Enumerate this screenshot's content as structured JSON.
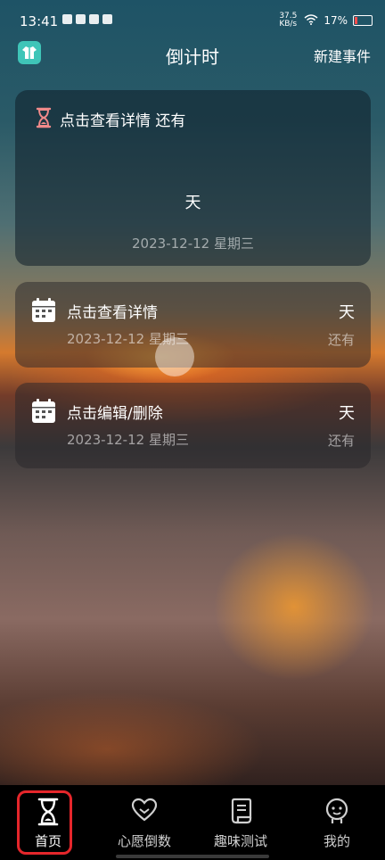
{
  "status_bar": {
    "time": "13:41",
    "net_speed": "37.5 KB/s",
    "battery": "17%"
  },
  "header": {
    "title": "倒计时",
    "action": "新建事件",
    "app_icon": "shirt-icon"
  },
  "hero": {
    "title": "点击查看详情 还有",
    "unit": "天",
    "date": "2023-12-12 星期三",
    "icon": "hourglass-icon"
  },
  "events": [
    {
      "title": "点击查看详情",
      "date": "2023-12-12 星期三",
      "unit": "天",
      "remain_label": "还有",
      "icon": "calendar-icon"
    },
    {
      "title": "点击编辑/删除",
      "date": "2023-12-12 星期三",
      "unit": "天",
      "remain_label": "还有",
      "icon": "calendar-icon"
    }
  ],
  "tabs": [
    {
      "label": "首页",
      "icon": "hourglass-icon",
      "active": true
    },
    {
      "label": "心愿倒数",
      "icon": "heart-icon",
      "active": false
    },
    {
      "label": "趣味测试",
      "icon": "scroll-icon",
      "active": false
    },
    {
      "label": "我的",
      "icon": "profile-icon",
      "active": false
    }
  ],
  "colors": {
    "highlight": "#e5262b",
    "app_icon_bg": "#3fc5b8"
  }
}
